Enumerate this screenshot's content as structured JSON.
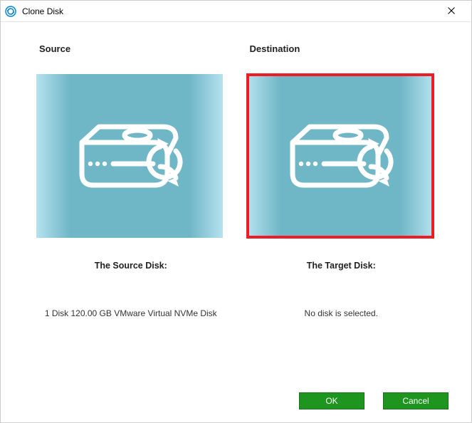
{
  "window": {
    "title": "Clone Disk"
  },
  "colors": {
    "accent_green": "#1e951e",
    "highlight_red": "#ee1c25",
    "tile_gradient_inner": "#6fb6c7",
    "tile_gradient_outer": "#b6e2ee"
  },
  "source": {
    "header": "Source",
    "label": "The Source Disk:",
    "detail": "1 Disk 120.00 GB VMware Virtual NVMe Disk",
    "selected": true
  },
  "destination": {
    "header": "Destination",
    "label": "The Target Disk:",
    "detail": "No disk is selected.",
    "highlighted": true
  },
  "buttons": {
    "ok": "OK",
    "cancel": "Cancel"
  },
  "icons": {
    "app": "clone-disk-app-icon",
    "close": "close-icon",
    "disk": "disk-sync-icon"
  }
}
